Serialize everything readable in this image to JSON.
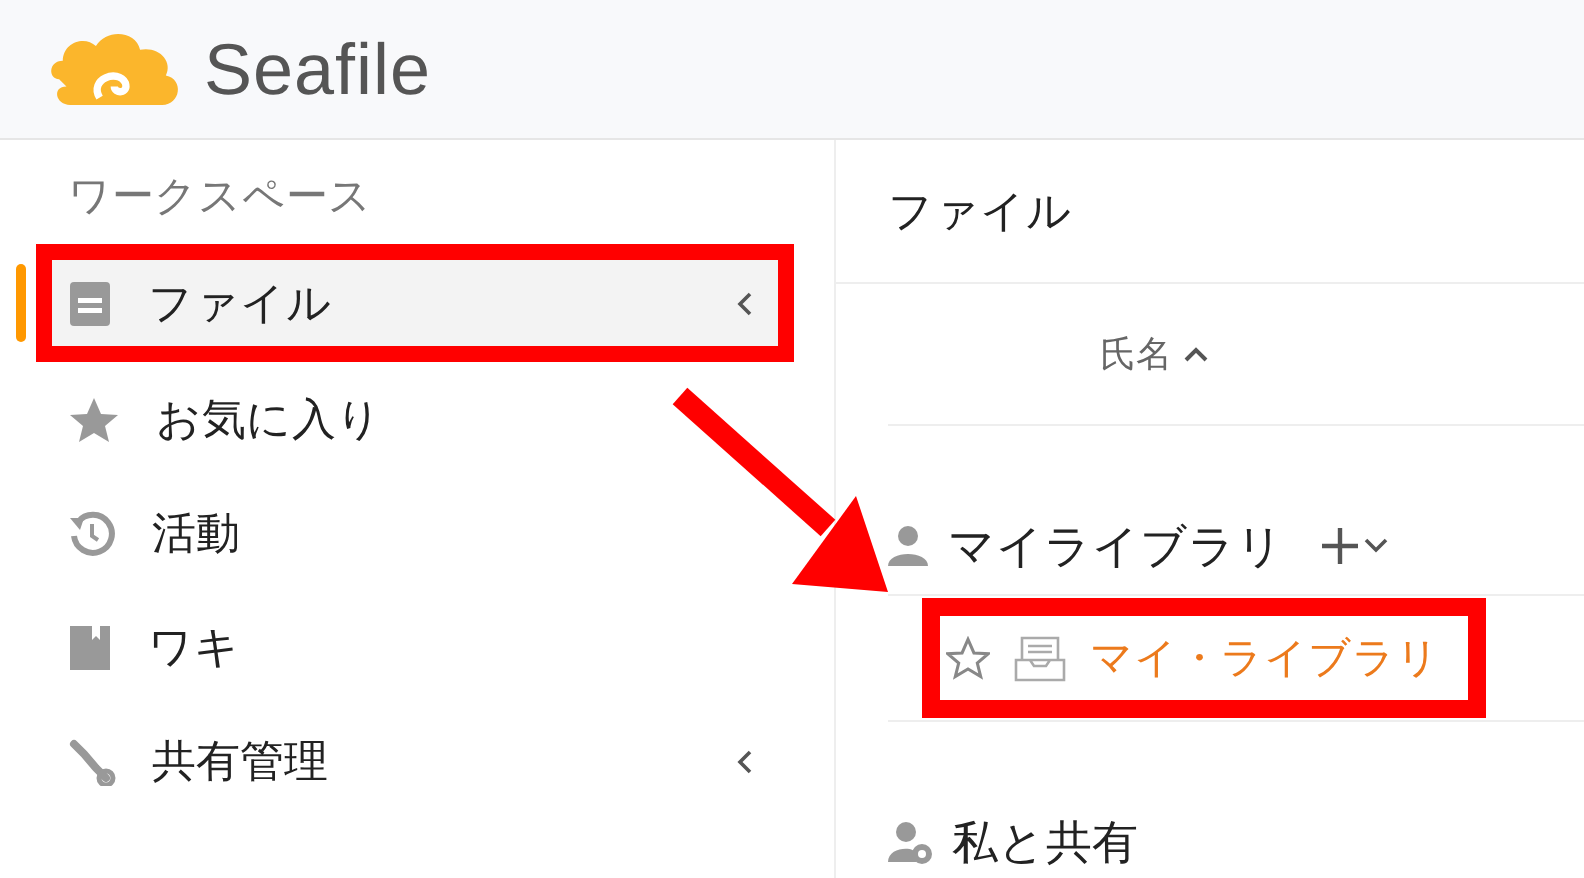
{
  "header": {
    "logo_text": "Seafile"
  },
  "sidebar": {
    "heading": "ワークスペース",
    "items": [
      {
        "label": "ファイル",
        "selected": true,
        "expandable": true,
        "highlighted": true
      },
      {
        "label": "お気に入り",
        "selected": false,
        "expandable": false,
        "highlighted": false
      },
      {
        "label": "活動",
        "selected": false,
        "expandable": false,
        "highlighted": false
      },
      {
        "label": "ワキ",
        "selected": false,
        "expandable": false,
        "highlighted": false
      },
      {
        "label": "共有管理",
        "selected": false,
        "expandable": true,
        "highlighted": false
      }
    ]
  },
  "main": {
    "title": "ファイル",
    "sort_column": {
      "label": "氏名",
      "ascending": true
    },
    "groups": [
      {
        "title": "マイライブラリ",
        "kind": "mine",
        "libraries": [
          {
            "name": "マイ・ライブラリ",
            "starred": false,
            "highlighted": true
          }
        ]
      },
      {
        "title": "私と共有",
        "kind": "shared"
      }
    ]
  },
  "annotation": {
    "kind": "arrow"
  }
}
